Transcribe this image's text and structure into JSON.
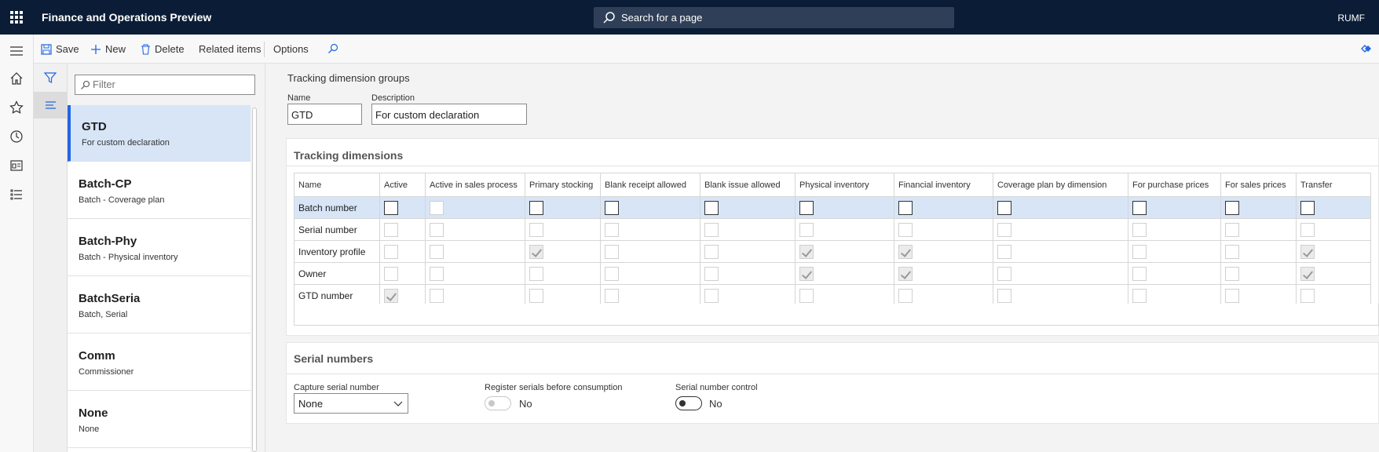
{
  "app": {
    "title": "Finance and Operations Preview",
    "user": "RUMF"
  },
  "search": {
    "placeholder": "Search for a page"
  },
  "actions": {
    "save": "Save",
    "new": "New",
    "delete": "Delete",
    "related": "Related items",
    "options": "Options"
  },
  "list": {
    "filter_placeholder": "Filter",
    "items": [
      {
        "title": "GTD",
        "subtitle": "For custom declaration",
        "selected": true
      },
      {
        "title": "Batch-CP",
        "subtitle": "Batch - Coverage plan"
      },
      {
        "title": "Batch-Phy",
        "subtitle": "Batch - Physical inventory"
      },
      {
        "title": "BatchSeria",
        "subtitle": "Batch, Serial"
      },
      {
        "title": "Comm",
        "subtitle": "Commissioner"
      },
      {
        "title": "None",
        "subtitle": "None"
      }
    ]
  },
  "form": {
    "page_caption": "Tracking dimension groups",
    "name_label": "Name",
    "name_value": "GTD",
    "description_label": "Description",
    "description_value": "For custom declaration"
  },
  "tracking": {
    "title": "Tracking dimensions",
    "columns": [
      "Name",
      "Active",
      "Active in sales process",
      "Primary stocking",
      "Blank receipt allowed",
      "Blank issue allowed",
      "Physical inventory",
      "Financial inventory",
      "Coverage plan by dimension",
      "For purchase prices",
      "For sales prices",
      "Transfer"
    ],
    "rows": [
      {
        "name": "Batch number",
        "checks": [
          false,
          false,
          false,
          false,
          false,
          false,
          false,
          false,
          false,
          false,
          false
        ],
        "enabled": [
          true,
          false,
          true,
          true,
          true,
          true,
          true,
          true,
          true,
          true,
          true
        ]
      },
      {
        "name": "Serial number",
        "checks": [
          false,
          false,
          false,
          false,
          false,
          false,
          false,
          false,
          false,
          false,
          false
        ],
        "enabled": [
          false,
          false,
          false,
          false,
          false,
          false,
          false,
          false,
          false,
          false,
          false
        ]
      },
      {
        "name": "Inventory profile",
        "checks": [
          false,
          false,
          true,
          false,
          false,
          true,
          true,
          false,
          false,
          false,
          true
        ],
        "enabled": [
          false,
          false,
          false,
          false,
          false,
          false,
          false,
          false,
          false,
          false,
          false
        ]
      },
      {
        "name": "Owner",
        "checks": [
          false,
          false,
          false,
          false,
          false,
          true,
          true,
          false,
          false,
          false,
          true
        ],
        "enabled": [
          false,
          false,
          false,
          false,
          false,
          false,
          false,
          false,
          false,
          false,
          false
        ]
      },
      {
        "name": "GTD number",
        "checks": [
          true,
          false,
          false,
          false,
          false,
          false,
          false,
          false,
          false,
          false,
          false
        ],
        "enabled": [
          false,
          false,
          false,
          false,
          false,
          false,
          false,
          false,
          false,
          false,
          false
        ]
      }
    ]
  },
  "serial": {
    "title": "Serial numbers",
    "capture_label": "Capture serial number",
    "capture_value": "None",
    "register_label": "Register serials before consumption",
    "register_value": "No",
    "control_label": "Serial number control",
    "control_value": "No"
  }
}
